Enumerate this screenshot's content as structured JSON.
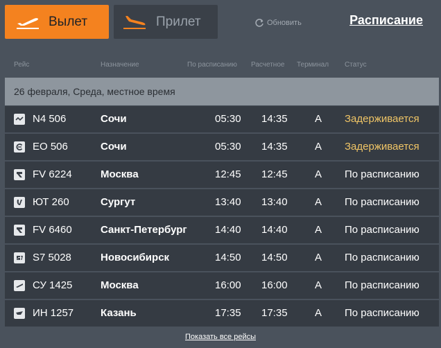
{
  "tabs": {
    "departure": "Вылет",
    "arrival": "Прилет"
  },
  "refresh_label": "Обновить",
  "schedule_link": "Расписание",
  "columns": {
    "flight": "Рейс",
    "destination": "Назначение",
    "scheduled": "По расписанию",
    "estimated": "Расчетное",
    "terminal": "Терминал",
    "status": "Статус"
  },
  "date_label": "26 февраля, Среда, местное время",
  "flights": [
    {
      "flight": "N4 506",
      "destination": "Сочи",
      "scheduled": "05:30",
      "estimated": "14:35",
      "terminal": "A",
      "status": "Задерживается",
      "delayed": true
    },
    {
      "flight": "EO 506",
      "destination": "Сочи",
      "scheduled": "05:30",
      "estimated": "14:35",
      "terminal": "A",
      "status": "Задерживается",
      "delayed": true
    },
    {
      "flight": "FV 6224",
      "destination": "Москва",
      "scheduled": "12:45",
      "estimated": "12:45",
      "terminal": "A",
      "status": "По расписанию",
      "delayed": false
    },
    {
      "flight": "ЮТ 260",
      "destination": "Сургут",
      "scheduled": "13:40",
      "estimated": "13:40",
      "terminal": "A",
      "status": "По расписанию",
      "delayed": false
    },
    {
      "flight": "FV 6460",
      "destination": "Санкт-Петербург",
      "scheduled": "14:40",
      "estimated": "14:40",
      "terminal": "A",
      "status": "По расписанию",
      "delayed": false
    },
    {
      "flight": "S7 5028",
      "destination": "Новосибирск",
      "scheduled": "14:50",
      "estimated": "14:50",
      "terminal": "A",
      "status": "По расписанию",
      "delayed": false
    },
    {
      "flight": "СУ 1425",
      "destination": "Москва",
      "scheduled": "16:00",
      "estimated": "16:00",
      "terminal": "A",
      "status": "По расписанию",
      "delayed": false
    },
    {
      "flight": "ИН 1257",
      "destination": "Казань",
      "scheduled": "17:35",
      "estimated": "17:35",
      "terminal": "A",
      "status": "По расписанию",
      "delayed": false
    }
  ],
  "show_all_link": "Показать все рейсы",
  "colors": {
    "accent": "#f4821f",
    "delayed": "#f0c566",
    "background": "#4a525c",
    "row": "#353b43"
  }
}
